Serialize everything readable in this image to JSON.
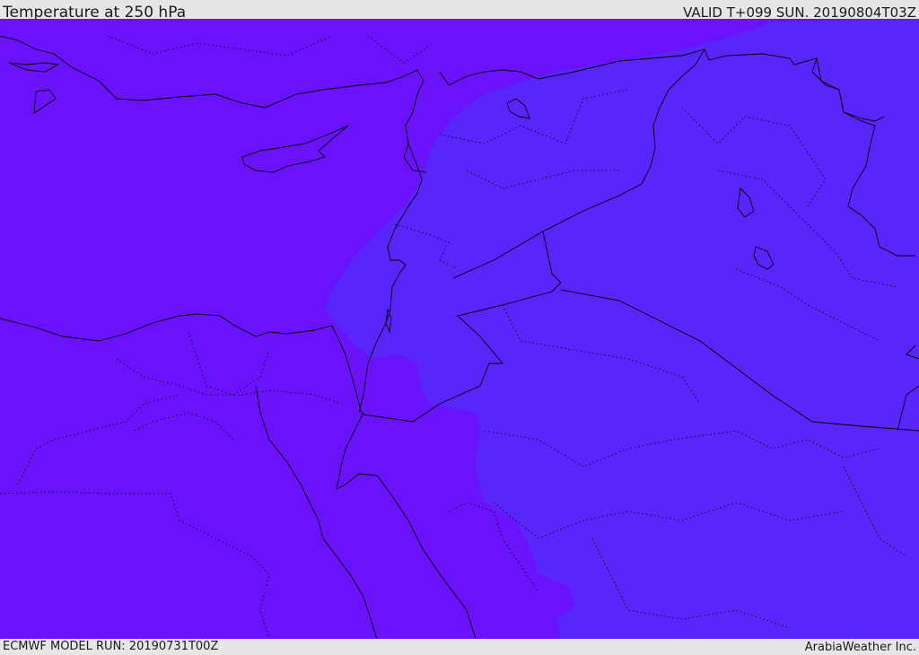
{
  "header": {
    "title": "Temperature at 250 hPa",
    "valid_time": "VALID T+099 SUN. 20190804T03Z"
  },
  "footer": {
    "model_run": "ECMWF MODEL RUN: 20190731T00Z",
    "provider": "ArabiaWeather Inc."
  },
  "map": {
    "field_colors": {
      "warmer_band": "#6a12fb",
      "cooler_band": "#5825fb"
    },
    "border_color": "#000000"
  }
}
